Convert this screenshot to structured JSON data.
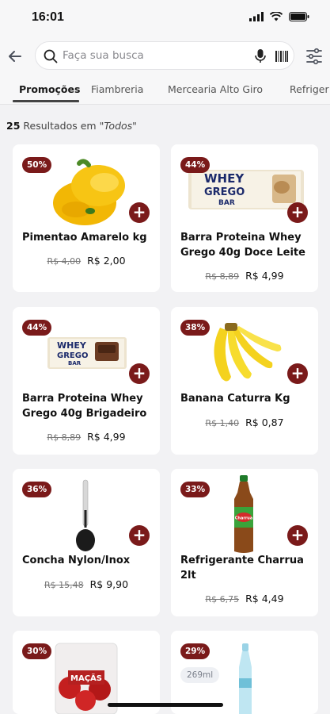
{
  "status": {
    "time": "16:01"
  },
  "search": {
    "placeholder": "Faça sua busca"
  },
  "tabs": [
    {
      "label": "Promoções",
      "active": true
    },
    {
      "label": "Fiambreria"
    },
    {
      "label": "Mercearia Alto Giro"
    },
    {
      "label": "Refriger"
    }
  ],
  "results": {
    "count": "25",
    "text": "Resultados em",
    "filter": "\"Todos\""
  },
  "products": [
    {
      "discount": "50%",
      "name": "Pimentao Amarelo  kg",
      "old_price": "R$ 4,00",
      "price": "R$ 2,00"
    },
    {
      "discount": "44%",
      "name": "Barra Proteina Whey Grego 40g Doce Leite",
      "old_price": "R$ 8,89",
      "price": "R$ 4,99"
    },
    {
      "discount": "44%",
      "name": "Barra Proteina Whey Grego 40g Brigadeiro",
      "old_price": "R$ 8,89",
      "price": "R$ 4,99"
    },
    {
      "discount": "38%",
      "name": "Banana Caturra Kg",
      "old_price": "R$ 1,40",
      "price": "R$ 0,87"
    },
    {
      "discount": "36%",
      "name": "Concha Nylon/Inox",
      "old_price": "R$ 15,48",
      "price": "R$ 9,90"
    },
    {
      "discount": "33%",
      "name": "Refrigerante Charrua 2lt",
      "old_price": "R$ 6,75",
      "price": "R$ 4,49"
    },
    {
      "discount": "30%",
      "name": "",
      "old_price": "",
      "price": "",
      "image_text": "MAÇÃS"
    },
    {
      "discount": "29%",
      "name": "",
      "old_price": "",
      "price": "",
      "volume": "269ml"
    }
  ],
  "product_image_text": {
    "whey_line1": "WHEY",
    "whey_line2": "GREGO",
    "whey_line3": "BAR",
    "charrua": "Charrua"
  },
  "colors": {
    "accent": "#7a1a1a",
    "background": "#f2f2f4"
  }
}
